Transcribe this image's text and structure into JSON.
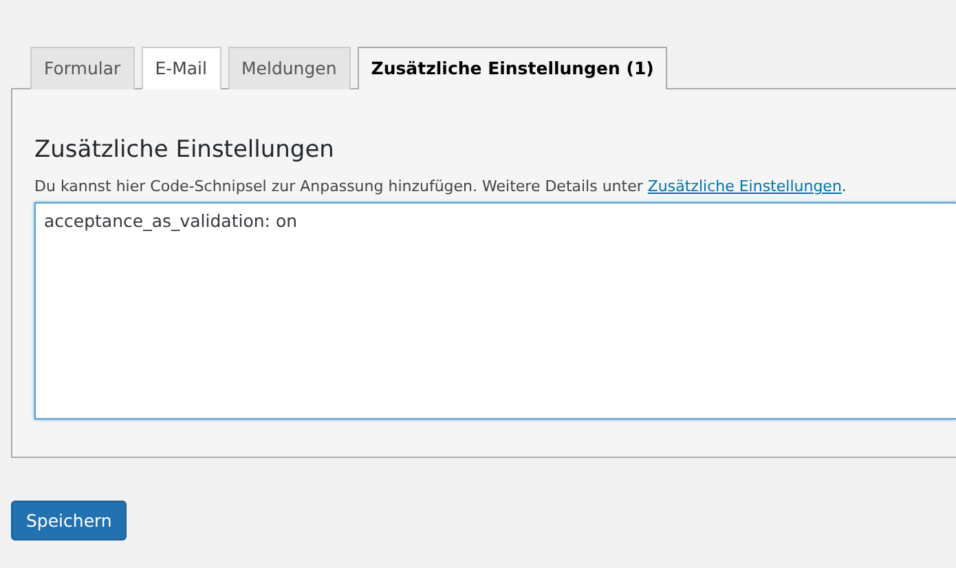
{
  "tabs": [
    {
      "label": "Formular",
      "selected": false,
      "hovered": false
    },
    {
      "label": "E-Mail",
      "selected": false,
      "hovered": true
    },
    {
      "label": "Meldungen",
      "selected": false,
      "hovered": false
    },
    {
      "label": "Zusätzliche Einstellungen (1)",
      "selected": true,
      "hovered": false
    }
  ],
  "panel": {
    "heading": "Zusätzliche Einstellungen",
    "description": "Du kannst hier Code-Schnipsel zur Anpassung hinzufügen. Weitere Details unter ",
    "link": "Zusätzliche Einstellungen",
    "description_end": ".",
    "value": "acceptance_as_validation: on"
  },
  "save_button": "Speichern"
}
